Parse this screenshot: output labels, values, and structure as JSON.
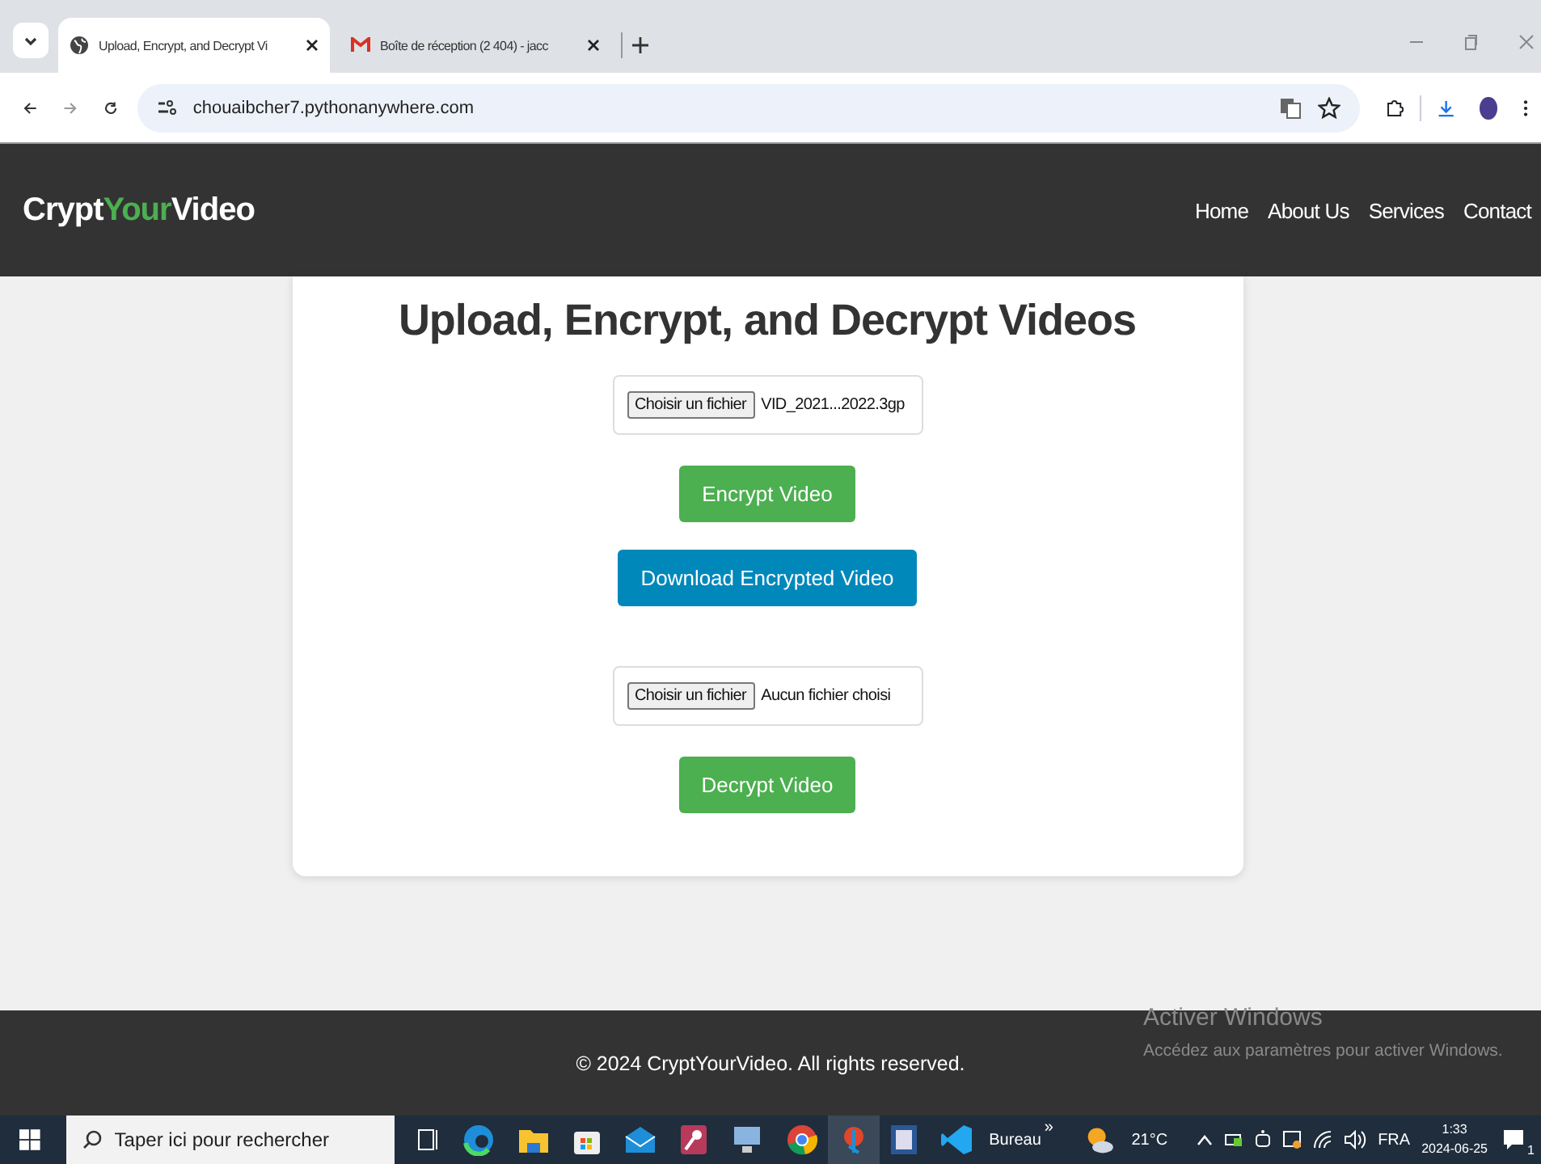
{
  "browser": {
    "tabs": [
      {
        "title": "Upload, Encrypt, and Decrypt Vi",
        "selected": true,
        "kind": "globe"
      },
      {
        "title": "Boîte de réception (2 404) - jacc",
        "selected": false,
        "kind": "mail"
      }
    ],
    "url": "chouaibcher7.pythonanywhere.com"
  },
  "site": {
    "logo": [
      {
        "text": "Crypt",
        "color": "#ffffff"
      },
      {
        "text": "Your",
        "color": "#4caf50"
      },
      {
        "text": "Video",
        "color": "#ffffff"
      }
    ],
    "nav": [
      "Home",
      "About Us",
      "Services",
      "Contact"
    ]
  },
  "card": {
    "title": "Upload, Encrypt, and Decrypt Videos",
    "items": [
      {
        "kind": "file",
        "button": "Choisir un fichier",
        "value": "VID_2021...2022.3gp"
      },
      {
        "kind": "button",
        "label": "Encrypt Video",
        "color": "#4caf50"
      },
      {
        "kind": "button",
        "label": "Download Encrypted Video",
        "color": "#0088bb"
      },
      {
        "kind": "file",
        "button": "Choisir un fichier",
        "value": "Aucun fichier choisi"
      },
      {
        "kind": "button",
        "label": "Decrypt Video",
        "color": "#4caf50"
      }
    ]
  },
  "footer": "© 2024 CryptYourVideo. All rights reserved.",
  "activation": {
    "title": "Activer Windows",
    "text": "Accédez aux paramètres pour activer Windows."
  },
  "taskbar": {
    "search_placeholder": "Taper ici pour rechercher",
    "bureau": "Bureau",
    "chevron": "»",
    "temperature": "21°C",
    "language": "FRA",
    "time": "1:33",
    "date": "2024-06-25",
    "notifications": "1"
  }
}
